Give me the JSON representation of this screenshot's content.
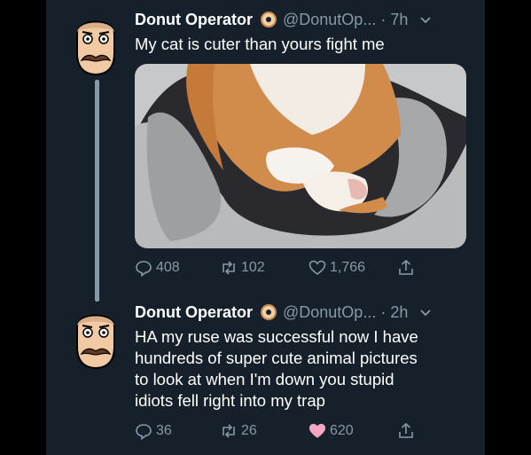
{
  "tweets": [
    {
      "display_name": "Donut Operator",
      "handle_time": "@DonutOp... · 7h",
      "text": "My cat is cuter than yours fight me",
      "stats": {
        "replies": "408",
        "retweets": "102",
        "likes": "1,766"
      },
      "liked": false
    },
    {
      "display_name": "Donut Operator",
      "handle_time": "@DonutOp... · 2h",
      "text_lines": [
        "HA my ruse was successful now I have",
        "hundreds of super cute animal pictures",
        "to look at when I'm down you stupid",
        "idiots fell right into my trap"
      ],
      "stats": {
        "replies": "36",
        "retweets": "26",
        "likes": "620"
      },
      "liked": true
    }
  ],
  "colors": {
    "background": "#15202b",
    "muted": "#8899a6",
    "like_active": "#e0245e",
    "like_active_soft": "#f4a6c4"
  },
  "icons": [
    "avatar-mustache-face",
    "donut-icon",
    "chevron-down-icon",
    "reply-icon",
    "retweet-icon",
    "heart-icon",
    "share-icon"
  ]
}
